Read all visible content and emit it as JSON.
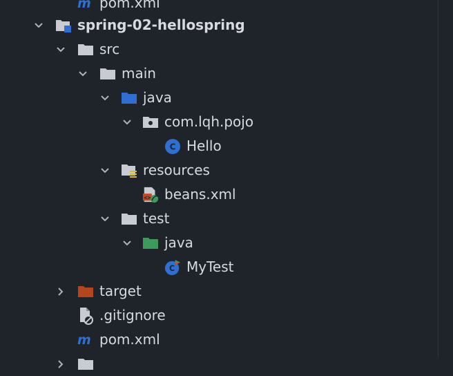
{
  "project_tree": {
    "items": [
      {
        "label": "pom.xml",
        "icon": "maven-icon"
      },
      {
        "label": "spring-02-hellospring",
        "icon": "module-folder-icon",
        "expanded": true
      },
      {
        "label": "src",
        "icon": "folder-icon",
        "expanded": true
      },
      {
        "label": "main",
        "icon": "folder-icon",
        "expanded": true
      },
      {
        "label": "java",
        "icon": "source-folder-icon",
        "expanded": true
      },
      {
        "label": "com.lqh.pojo",
        "icon": "package-icon",
        "expanded": true
      },
      {
        "label": "Hello",
        "icon": "java-class-icon"
      },
      {
        "label": "resources",
        "icon": "resources-folder-icon",
        "expanded": true
      },
      {
        "label": "beans.xml",
        "icon": "spring-xml-icon"
      },
      {
        "label": "test",
        "icon": "folder-icon",
        "expanded": true
      },
      {
        "label": "java",
        "icon": "test-source-folder-icon",
        "expanded": true
      },
      {
        "label": "MyTest",
        "icon": "java-test-class-icon"
      },
      {
        "label": "target",
        "icon": "excluded-folder-icon",
        "expanded": false
      },
      {
        "label": ".gitignore",
        "icon": "ignored-file-icon"
      },
      {
        "label": "pom.xml",
        "icon": "maven-icon"
      }
    ]
  },
  "colors": {
    "background": "#1f232a",
    "text": "#d7dbe0",
    "folder": "#c8ccd2",
    "source_folder": "#2f6fd1",
    "test_folder": "#3d9a5c",
    "excluded_folder": "#b5451b",
    "class_icon": "#2f6fd1",
    "maven": "#2f6fd1"
  }
}
